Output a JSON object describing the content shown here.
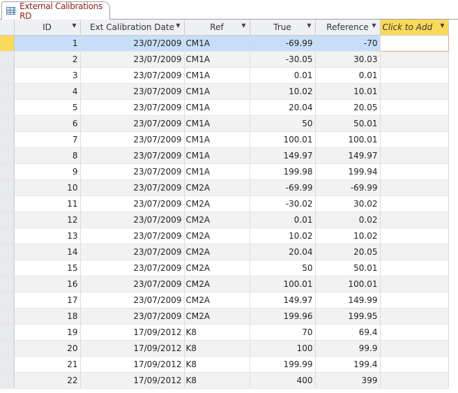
{
  "tab": {
    "title": "External Calibrations RD",
    "icon": "table-icon"
  },
  "columns": [
    "ID",
    "Ext Calibration Date",
    "Ref",
    "True",
    "Reference",
    "Click to Add"
  ],
  "rows": [
    [
      "1",
      "23/07/2009",
      "CM1A",
      "-69.99",
      "-70"
    ],
    [
      "2",
      "23/07/2009",
      "CM1A",
      "-30.05",
      "30.03"
    ],
    [
      "3",
      "23/07/2009",
      "CM1A",
      "0.01",
      "0.01"
    ],
    [
      "4",
      "23/07/2009",
      "CM1A",
      "10.02",
      "10.01"
    ],
    [
      "5",
      "23/07/2009",
      "CM1A",
      "20.04",
      "20.05"
    ],
    [
      "6",
      "23/07/2009",
      "CM1A",
      "50",
      "50.01"
    ],
    [
      "7",
      "23/07/2009",
      "CM1A",
      "100.01",
      "100.01"
    ],
    [
      "8",
      "23/07/2009",
      "CM1A",
      "149.97",
      "149.97"
    ],
    [
      "9",
      "23/07/2009",
      "CM1A",
      "199.98",
      "199.94"
    ],
    [
      "10",
      "23/07/2009",
      "CM2A",
      "-69.99",
      "-69.99"
    ],
    [
      "11",
      "23/07/2009",
      "CM2A",
      "-30.02",
      "30.02"
    ],
    [
      "12",
      "23/07/2009",
      "CM2A",
      "0.01",
      "0.02"
    ],
    [
      "13",
      "23/07/2009",
      "CM2A",
      "10.02",
      "10.02"
    ],
    [
      "14",
      "23/07/2009",
      "CM2A",
      "20.04",
      "20.05"
    ],
    [
      "15",
      "23/07/2009",
      "CM2A",
      "50",
      "50.01"
    ],
    [
      "16",
      "23/07/2009",
      "CM2A",
      "100.01",
      "100.01"
    ],
    [
      "17",
      "23/07/2009",
      "CM2A",
      "149.97",
      "149.99"
    ],
    [
      "18",
      "23/07/2009",
      "CM2A",
      "199.96",
      "199.95"
    ],
    [
      "19",
      "17/09/2012",
      "K8",
      "70",
      "69.4"
    ],
    [
      "20",
      "17/09/2012",
      "K8",
      "100",
      "99.9"
    ],
    [
      "21",
      "17/09/2012",
      "K8",
      "199.99",
      "199.4"
    ],
    [
      "22",
      "17/09/2012",
      "K8",
      "400",
      "399"
    ]
  ],
  "selected_row": 0
}
